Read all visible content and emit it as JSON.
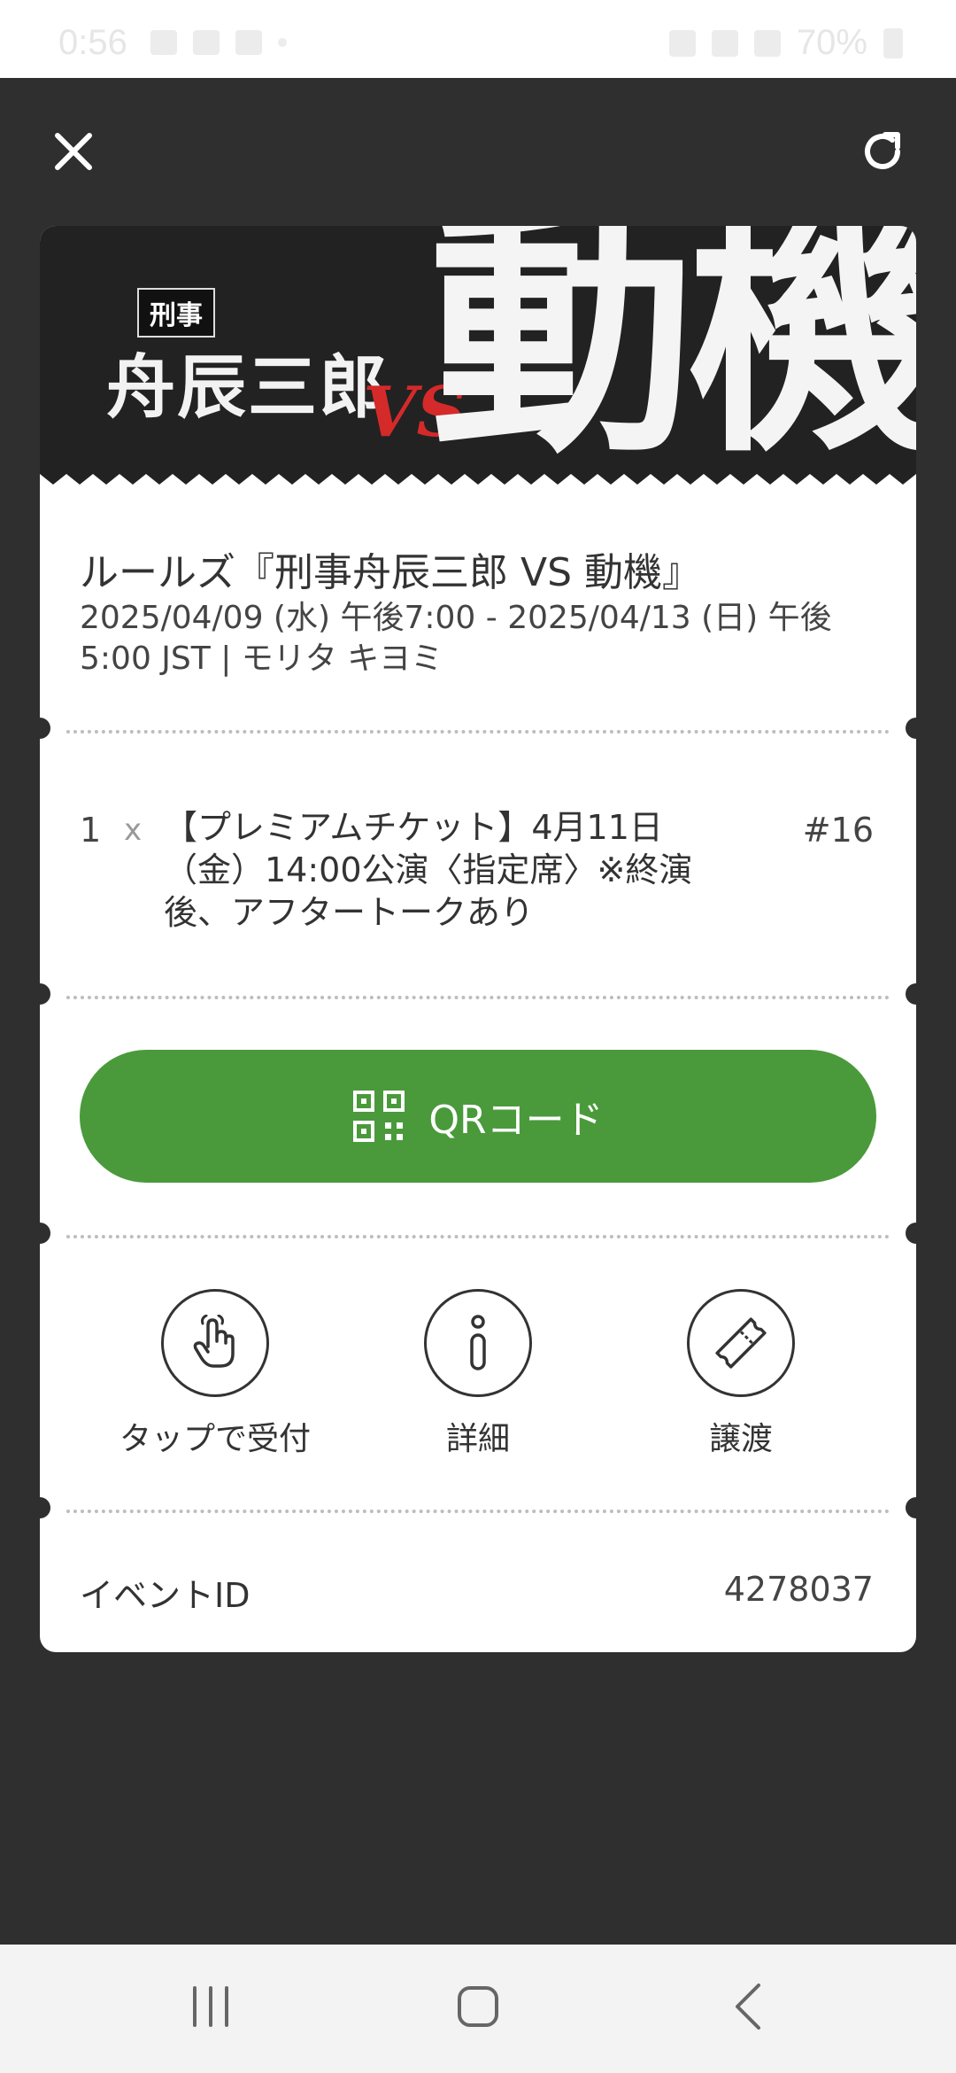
{
  "status_bar": {
    "time": "0:56",
    "battery": "70%"
  },
  "banner": {
    "tag": "刑事",
    "name": "舟辰三郎",
    "vs": "VS",
    "motive": "動機"
  },
  "ticket": {
    "title": "ルールズ『刑事舟辰三郎 VS 動機』",
    "date_line1": "2025/04/09 (水) 午後7:00 - 2025/04/13 (日) 午後",
    "date_line2": "5:00 JST | モリタ キヨミ",
    "item": {
      "quantity": "1",
      "times": "x",
      "description": "【プレミアムチケット】4月11日（金）14:00公演〈指定席〉※終演後、アフタートークあり",
      "number": "#16"
    },
    "qr_button_label": "QRコード",
    "actions": [
      {
        "label": "タップで受付",
        "icon": "tap-hand-icon"
      },
      {
        "label": "詳細",
        "icon": "info-icon"
      },
      {
        "label": "譲渡",
        "icon": "ticket-transfer-icon"
      }
    ],
    "event_id_label": "イベントID",
    "event_id_value": "4278037"
  },
  "colors": {
    "background": "#2f2f2f",
    "accent_green": "#4a9a3b",
    "card": "#ffffff"
  }
}
